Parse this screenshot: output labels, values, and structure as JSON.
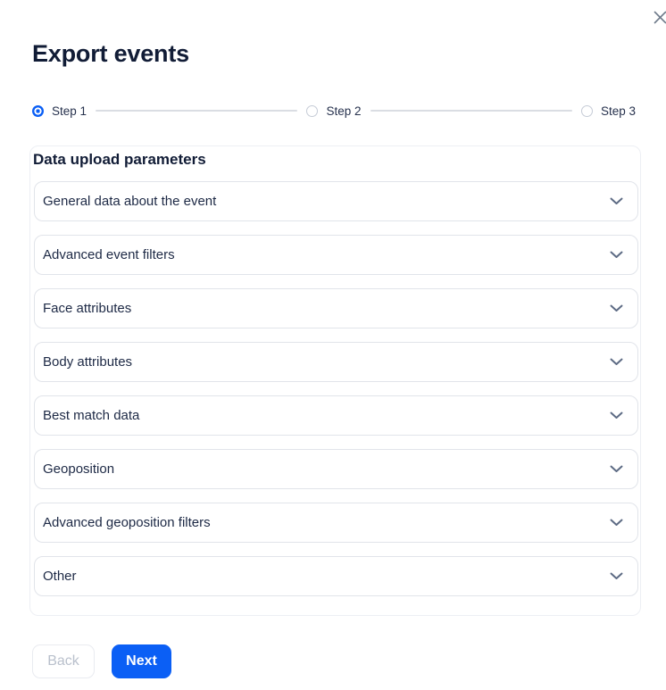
{
  "modal": {
    "title": "Export events"
  },
  "stepper": {
    "steps": [
      {
        "label": "Step 1",
        "active": true
      },
      {
        "label": "Step 2",
        "active": false
      },
      {
        "label": "Step 3",
        "active": false
      }
    ]
  },
  "panel": {
    "title": "Data upload parameters",
    "sections": [
      "General data about the event",
      "Advanced event filters",
      "Face attributes",
      "Body attributes",
      "Best match data",
      "Geoposition",
      "Advanced geoposition filters",
      "Other"
    ]
  },
  "footer": {
    "back_label": "Back",
    "next_label": "Next"
  },
  "colors": {
    "accent_blue": "#0b5ff5",
    "text_dark": "#111c36",
    "row_border": "#e1e4ea",
    "panel_border": "#edeff4",
    "chevron": "#5d6b84",
    "disabled_text": "#b9c0cc"
  }
}
